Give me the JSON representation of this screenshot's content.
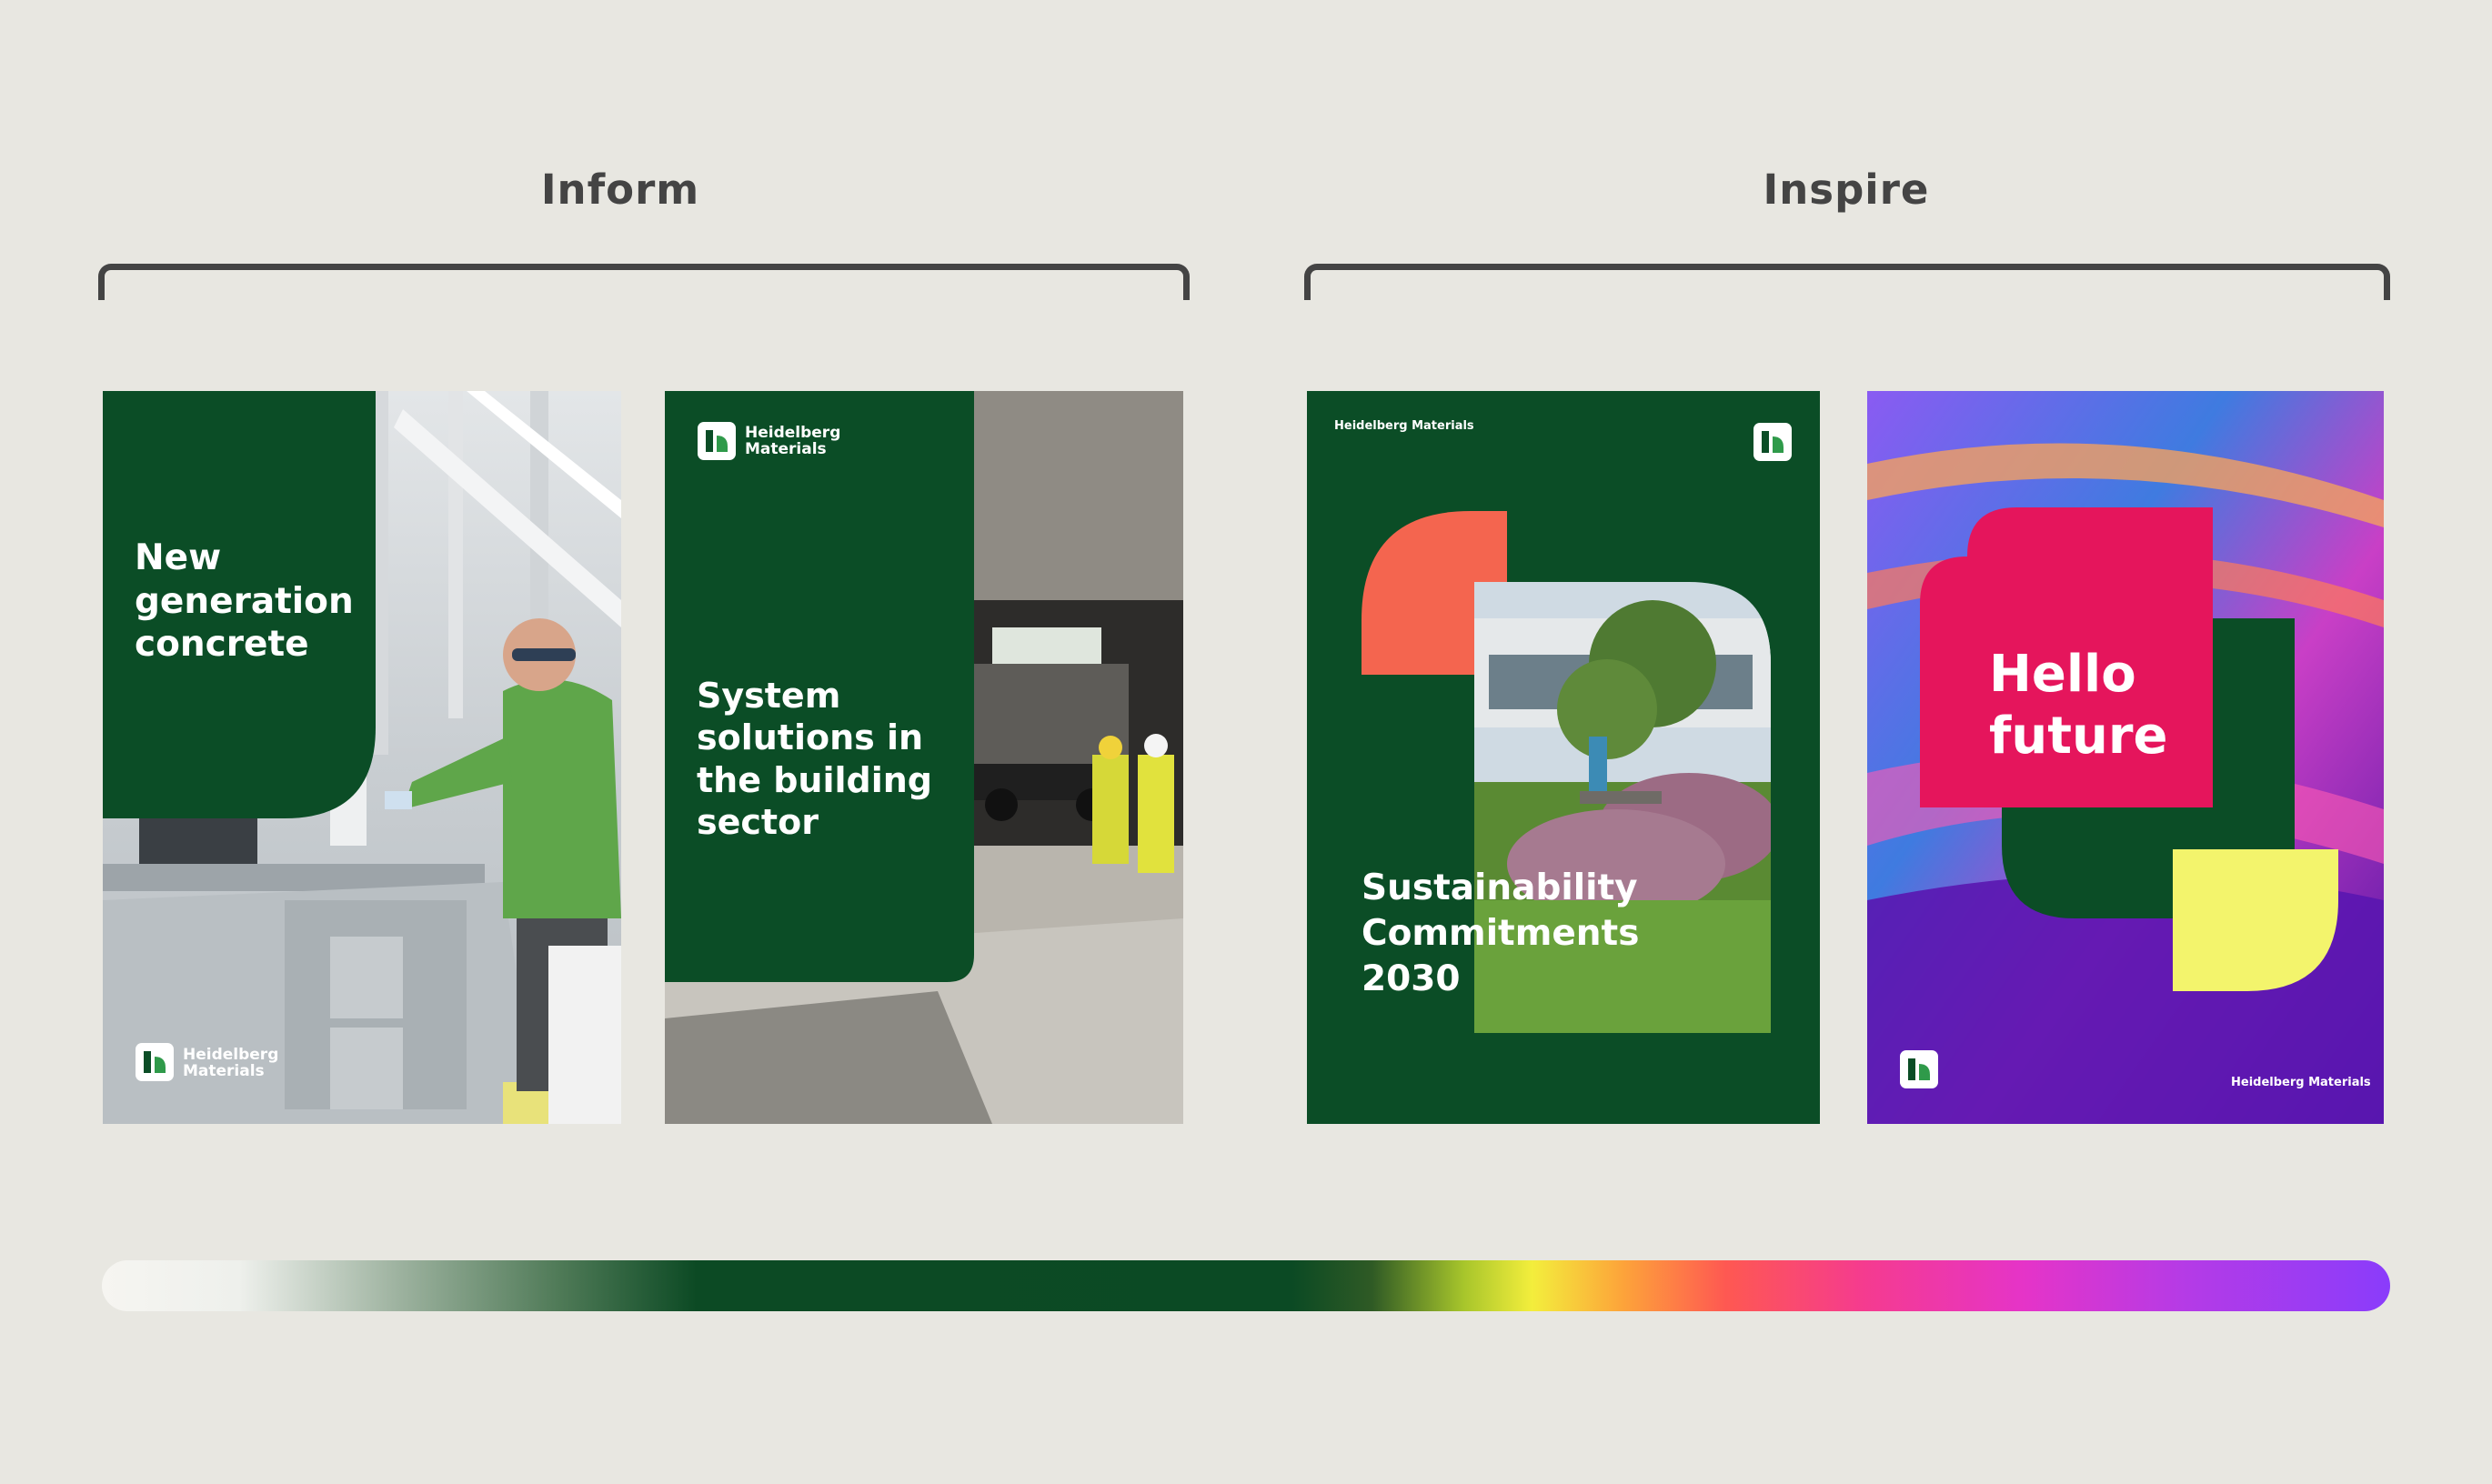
{
  "sections": {
    "inform": "Inform",
    "inspire": "Inspire"
  },
  "posters": [
    {
      "headline": "New\ngeneration\nconcrete",
      "brand": "Heidelberg\nMaterials",
      "photo": "Lab technician in green shirt and safety glasses working at laboratory bench"
    },
    {
      "headline": "System\nsolutions in\nthe building\nsector",
      "brand": "Heidelberg\nMaterials",
      "photo": "Two workers in high-visibility gear beside a truck under a concrete structure"
    },
    {
      "headline": "Sustainability\nCommitments\n2030",
      "brand": "Heidelberg Materials",
      "photo": "Person seated on a bench in a green garden outside an office building"
    },
    {
      "headline": "Hello\nfuture",
      "brand": "Heidelberg Materials",
      "photo": "Abstract colorful flowing background"
    }
  ],
  "colors": {
    "background": "#e8e7e1",
    "ink": "#444444",
    "brand_green": "#0b4d26",
    "coral": "#f4654f",
    "magenta": "#e5155c",
    "yellow": "#f3f46c",
    "purple": "#6a16b8"
  },
  "icons": [
    "heidelberg-logo-icon"
  ],
  "spectrum_label": ""
}
